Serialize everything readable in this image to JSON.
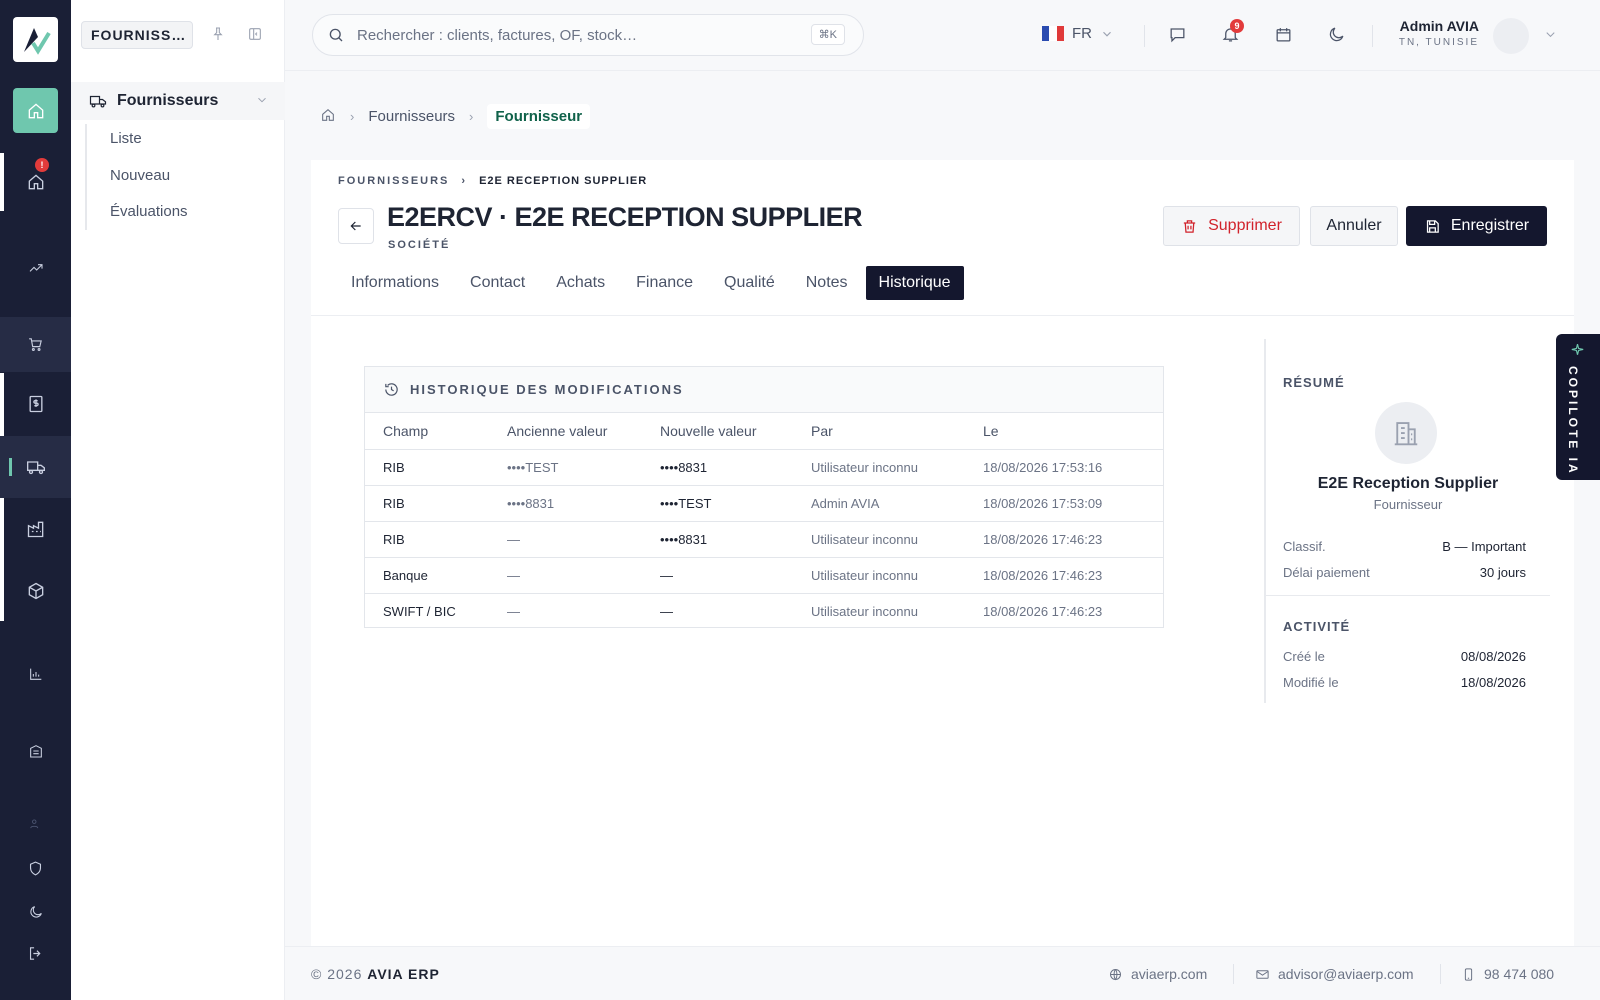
{
  "workspace_chip": "FOURNISS…",
  "sidebar": {
    "group_label": "Fournisseurs",
    "items": [
      {
        "label": "Liste"
      },
      {
        "label": "Nouveau"
      },
      {
        "label": "Évaluations"
      }
    ]
  },
  "rail": {
    "alert_badge": "!"
  },
  "search": {
    "placeholder": "Rechercher : clients, factures, OF, stock…",
    "shortcut": "⌘K"
  },
  "topbar": {
    "lang": "FR",
    "notif_count": "9"
  },
  "user": {
    "name": "Admin AVIA",
    "location": "TN, TUNISIE"
  },
  "breadcrumb": {
    "parent": "Fournisseurs",
    "current": "Fournisseur"
  },
  "header": {
    "mini_parent": "FOURNISSEURS",
    "mini_current": "E2E RECEPTION SUPPLIER",
    "title": "E2ERCV · E2E RECEPTION SUPPLIER",
    "subtitle": "SOCIÉTÉ",
    "delete_label": "Supprimer",
    "cancel_label": "Annuler",
    "save_label": "Enregistrer"
  },
  "tabs": [
    {
      "label": "Informations"
    },
    {
      "label": "Contact"
    },
    {
      "label": "Achats"
    },
    {
      "label": "Finance"
    },
    {
      "label": "Qualité"
    },
    {
      "label": "Notes"
    },
    {
      "label": "Historique"
    }
  ],
  "history": {
    "title": "HISTORIQUE DES MODIFICATIONS",
    "columns": [
      "Champ",
      "Ancienne valeur",
      "Nouvelle valeur",
      "Par",
      "Le"
    ],
    "rows": [
      [
        "RIB",
        "••••TEST",
        "••••8831",
        "Utilisateur inconnu",
        "18/08/2026 17:53:16"
      ],
      [
        "RIB",
        "••••8831",
        "••••TEST",
        "Admin AVIA",
        "18/08/2026 17:53:09"
      ],
      [
        "RIB",
        "—",
        "••••8831",
        "Utilisateur inconnu",
        "18/08/2026 17:46:23"
      ],
      [
        "Banque",
        "—",
        "—",
        "Utilisateur inconnu",
        "18/08/2026 17:46:23"
      ],
      [
        "SWIFT / BIC",
        "—",
        "—",
        "Utilisateur inconnu",
        "18/08/2026 17:46:23"
      ]
    ]
  },
  "summary": {
    "label": "RÉSUMÉ",
    "name": "E2E Reception Supplier",
    "type": "Fournisseur",
    "classif_key": "Classif.",
    "classif_val": "B — Important",
    "delai_key": "Délai paiement",
    "delai_val": "30 jours",
    "activity_label": "ACTIVITÉ",
    "created_key": "Créé le",
    "created_val": "08/08/2026",
    "modified_key": "Modifié le",
    "modified_val": "18/08/2026"
  },
  "copilot": "COPILOTE IA",
  "footer": {
    "copyright": "© 2026",
    "brand": "AVIA ERP",
    "site": "aviaerp.com",
    "email": "advisor@aviaerp.com",
    "phone": "98 474 080"
  }
}
